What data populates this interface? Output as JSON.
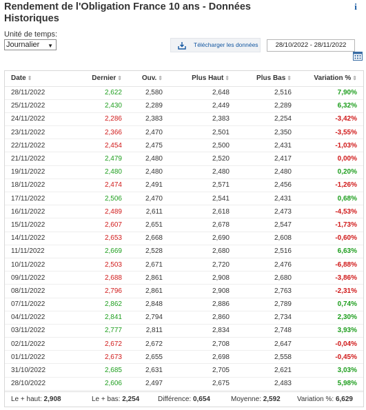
{
  "page": {
    "title": "Rendement de l'Obligation France 10 ans - Données Historiques",
    "info_icon": "i"
  },
  "controls": {
    "unit_label": "Unité de temps:",
    "unit_value": "Journalier",
    "download_label": "Télécharger les données",
    "date_range": "28/10/2022 - 28/11/2022"
  },
  "colors": {
    "positive": "#1e9e1e",
    "negative": "#d01919",
    "link": "#1256a0"
  },
  "table": {
    "headers": {
      "date": "Date",
      "last": "Dernier",
      "open": "Ouv.",
      "high": "Plus Haut",
      "low": "Plus Bas",
      "change": "Variation %"
    },
    "rows": [
      {
        "date": "28/11/2022",
        "last": "2,622",
        "open": "2,580",
        "high": "2,648",
        "low": "2,516",
        "change": "7,90%",
        "dir": "up"
      },
      {
        "date": "25/11/2022",
        "last": "2,430",
        "open": "2,289",
        "high": "2,449",
        "low": "2,289",
        "change": "6,32%",
        "dir": "up"
      },
      {
        "date": "24/11/2022",
        "last": "2,286",
        "open": "2,383",
        "high": "2,383",
        "low": "2,254",
        "change": "-3,42%",
        "dir": "down"
      },
      {
        "date": "23/11/2022",
        "last": "2,366",
        "open": "2,470",
        "high": "2,501",
        "low": "2,350",
        "change": "-3,55%",
        "dir": "down"
      },
      {
        "date": "22/11/2022",
        "last": "2,454",
        "open": "2,475",
        "high": "2,500",
        "low": "2,431",
        "change": "-1,03%",
        "dir": "down"
      },
      {
        "date": "21/11/2022",
        "last": "2,479",
        "open": "2,480",
        "high": "2,520",
        "low": "2,417",
        "change": "0,00%",
        "dir": "flat"
      },
      {
        "date": "19/11/2022",
        "last": "2,480",
        "open": "2,480",
        "high": "2,480",
        "low": "2,480",
        "change": "0,20%",
        "dir": "up"
      },
      {
        "date": "18/11/2022",
        "last": "2,474",
        "open": "2,491",
        "high": "2,571",
        "low": "2,456",
        "change": "-1,26%",
        "dir": "down"
      },
      {
        "date": "17/11/2022",
        "last": "2,506",
        "open": "2,470",
        "high": "2,541",
        "low": "2,431",
        "change": "0,68%",
        "dir": "up"
      },
      {
        "date": "16/11/2022",
        "last": "2,489",
        "open": "2,611",
        "high": "2,618",
        "low": "2,473",
        "change": "-4,53%",
        "dir": "down"
      },
      {
        "date": "15/11/2022",
        "last": "2,607",
        "open": "2,651",
        "high": "2,678",
        "low": "2,547",
        "change": "-1,73%",
        "dir": "down"
      },
      {
        "date": "14/11/2022",
        "last": "2,653",
        "open": "2,668",
        "high": "2,690",
        "low": "2,608",
        "change": "-0,60%",
        "dir": "down"
      },
      {
        "date": "11/11/2022",
        "last": "2,669",
        "open": "2,528",
        "high": "2,680",
        "low": "2,516",
        "change": "6,63%",
        "dir": "up"
      },
      {
        "date": "10/11/2022",
        "last": "2,503",
        "open": "2,671",
        "high": "2,720",
        "low": "2,476",
        "change": "-6,88%",
        "dir": "down"
      },
      {
        "date": "09/11/2022",
        "last": "2,688",
        "open": "2,861",
        "high": "2,908",
        "low": "2,680",
        "change": "-3,86%",
        "dir": "down"
      },
      {
        "date": "08/11/2022",
        "last": "2,796",
        "open": "2,861",
        "high": "2,908",
        "low": "2,763",
        "change": "-2,31%",
        "dir": "down"
      },
      {
        "date": "07/11/2022",
        "last": "2,862",
        "open": "2,848",
        "high": "2,886",
        "low": "2,789",
        "change": "0,74%",
        "dir": "up"
      },
      {
        "date": "04/11/2022",
        "last": "2,841",
        "open": "2,794",
        "high": "2,860",
        "low": "2,734",
        "change": "2,30%",
        "dir": "up"
      },
      {
        "date": "03/11/2022",
        "last": "2,777",
        "open": "2,811",
        "high": "2,834",
        "low": "2,748",
        "change": "3,93%",
        "dir": "up"
      },
      {
        "date": "02/11/2022",
        "last": "2,672",
        "open": "2,672",
        "high": "2,708",
        "low": "2,647",
        "change": "-0,04%",
        "dir": "down"
      },
      {
        "date": "01/11/2022",
        "last": "2,673",
        "open": "2,655",
        "high": "2,698",
        "low": "2,558",
        "change": "-0,45%",
        "dir": "down"
      },
      {
        "date": "31/10/2022",
        "last": "2,685",
        "open": "2,631",
        "high": "2,705",
        "low": "2,621",
        "change": "3,03%",
        "dir": "up"
      },
      {
        "date": "28/10/2022",
        "last": "2,606",
        "open": "2,497",
        "high": "2,675",
        "low": "2,483",
        "change": "5,98%",
        "dir": "up"
      }
    ]
  },
  "summary": {
    "high_label": "Le + haut:",
    "high_value": "2,908",
    "low_label": "Le + bas:",
    "low_value": "2,254",
    "diff_label": "Différence:",
    "diff_value": "0,654",
    "avg_label": "Moyenne:",
    "avg_value": "2,592",
    "change_label": "Variation %:",
    "change_value": "6,629"
  }
}
